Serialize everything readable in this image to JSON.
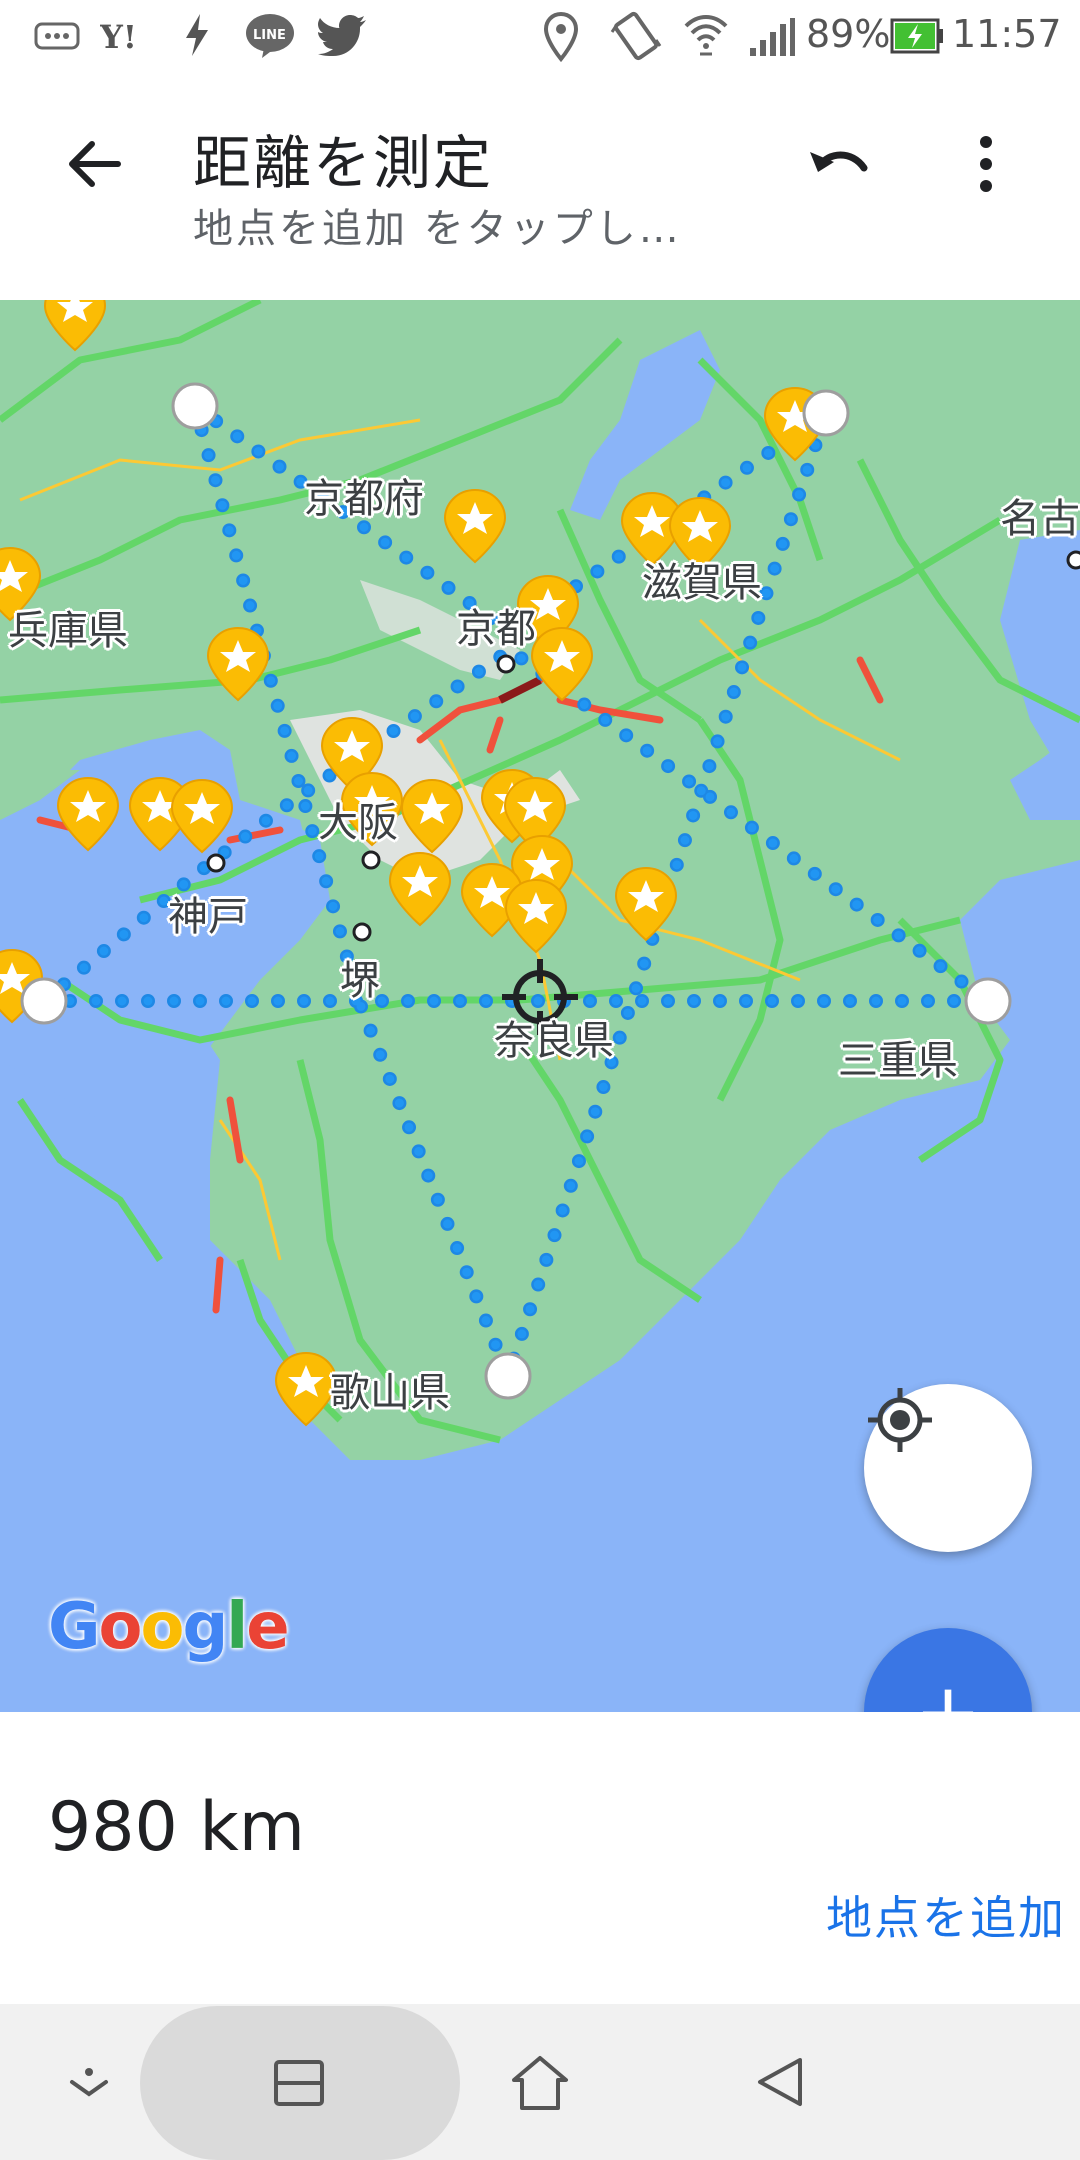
{
  "status_bar": {
    "battery": "89%",
    "time": "11:57",
    "left_icons": [
      "voicemail-icon",
      "yahoo-icon",
      "flash-icon",
      "line-icon",
      "twitter-icon"
    ],
    "right_icons": [
      "location-pin-icon",
      "vibrate-icon",
      "wifi-icon",
      "signal-icon",
      "battery-charging-icon"
    ]
  },
  "app_bar": {
    "title": "距離を測定",
    "subtitle": "地点を追加 をタップし…",
    "back_icon": "arrow-back-icon",
    "undo_icon": "undo-icon",
    "more_icon": "more-vert-icon"
  },
  "map": {
    "labels": {
      "kyoto_fu": "京都府",
      "hyogo": "兵庫県",
      "kyoto": "京都",
      "shiga": "滋賀県",
      "nagoya": "名古",
      "osaka": "大阪",
      "kobe": "神戸",
      "sakai": "堺",
      "nara": "奈良県",
      "mie": "三重県",
      "wakayama": "歌山県"
    },
    "logo": "Google",
    "colors": {
      "water": "#8ab4f8",
      "land": "#94d2a5",
      "traffic_green": "#63d668",
      "traffic_red": "#f0513c",
      "measure_line": "#1e88e5",
      "favorite_pin": "#fbbc04"
    }
  },
  "fab": {
    "location_icon": "my-location-icon",
    "add_icon": "plus-icon",
    "add_label": "+"
  },
  "sheet": {
    "distance": "980 km",
    "add_point_label": "地点を追加"
  },
  "nav_bar": {
    "icons": [
      "hide-keyboard-icon",
      "recents-icon",
      "home-icon",
      "back-triangle-icon"
    ]
  }
}
